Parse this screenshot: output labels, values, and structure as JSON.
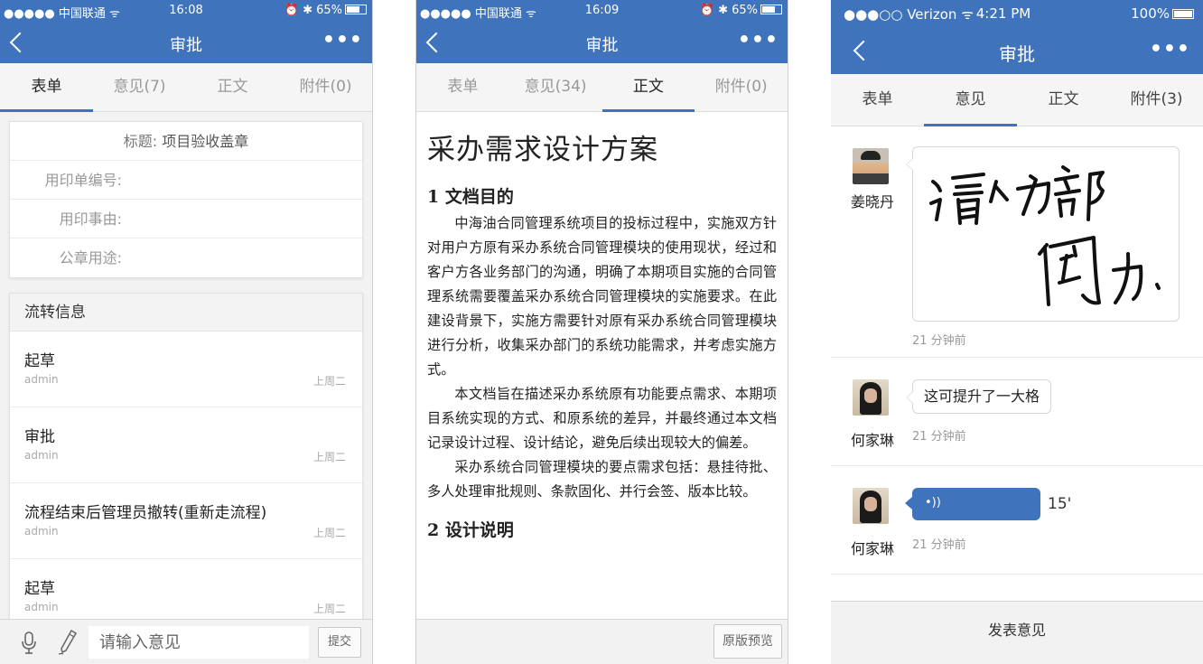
{
  "screen1": {
    "status": {
      "carrier": "●●●●● 中国联通 ᯤ",
      "time": "16:08",
      "battery": "65%",
      "icons": "alarm-bluetooth"
    },
    "nav": {
      "title": "审批",
      "more": "•••"
    },
    "tabs": [
      {
        "label": "表单",
        "active": true
      },
      {
        "label": "意见(7)",
        "active": false
      },
      {
        "label": "正文",
        "active": false
      },
      {
        "label": "附件(0)",
        "active": false
      }
    ],
    "form": {
      "title_label": "标题:",
      "title_value": "项目验收盖章",
      "fields": [
        "用印单编号:",
        "用印事由:",
        "公章用途:"
      ]
    },
    "flow": {
      "heading": "流转信息",
      "items": [
        {
          "name": "起草",
          "user": "admin",
          "when": "上周二"
        },
        {
          "name": "审批",
          "user": "admin",
          "when": "上周二"
        },
        {
          "name": "流程结束后管理员撤转(重新走流程)",
          "user": "admin",
          "when": "上周二"
        },
        {
          "name": "起草",
          "user": "admin",
          "when": "上周二"
        }
      ]
    },
    "input": {
      "placeholder": "请输入意见"
    },
    "submit": "提交"
  },
  "screen2": {
    "status": {
      "carrier": "●●●●● 中国联通 ᯤ",
      "time": "16:09",
      "battery": "65%"
    },
    "nav": {
      "title": "审批",
      "more": "•••"
    },
    "tabs": [
      {
        "label": "表单",
        "active": false
      },
      {
        "label": "意见(34)",
        "active": false
      },
      {
        "label": "正文",
        "active": true
      },
      {
        "label": "附件(0)",
        "active": false
      }
    ],
    "doc": {
      "title": "采办需求设计方案",
      "h1": "1 文档目的",
      "paragraphs": [
        "中海油合同管理系统项目的投标过程中，实施双方针对用户方原有采办系统合同管理模块的使用现状，经过和客户方各业务部门的沟通，明确了本期项目实施的合同管理系统需要覆盖采办系统合同管理模块的实施要求。在此建设背景下，实施方需要针对原有采办系统合同管理模块进行分析，收集采办部门的系统功能需求，并考虑实施方式。",
        "本文档旨在描述采办系统原有功能要点需求、本期项目系统实现的方式、和原系统的差异，并最终通过本文档记录设计过程、设计结论，避免后续出现较大的偏差。",
        "采办系统合同管理模块的要点需求包括：悬挂待批、多人处理审批规则、条款固化、并行会签、版本比较。"
      ],
      "h2": "2 设计说明"
    },
    "preview": "原版预览"
  },
  "screen3": {
    "status": {
      "carrier": "●●●○○ Verizon ᯤ",
      "time": "4:21 PM",
      "battery": "100%"
    },
    "nav": {
      "title": "审批",
      "more": "•••"
    },
    "tabs": [
      {
        "label": "表单",
        "active": false
      },
      {
        "label": "意见",
        "active": true
      },
      {
        "label": "正文",
        "active": false
      },
      {
        "label": "附件(3)",
        "active": false
      }
    ],
    "comments": [
      {
        "name": "姜晓丹",
        "type": "handwriting",
        "content": "请人力部阅办.",
        "time": "21 分钟前"
      },
      {
        "name": "何家琳",
        "type": "text",
        "content": "这可提升了一大格",
        "time": "21 分钟前"
      },
      {
        "name": "何家琳",
        "type": "voice",
        "content": "•))",
        "duration": "15'",
        "time": "21 分钟前"
      }
    ],
    "publish": "发表意见"
  }
}
